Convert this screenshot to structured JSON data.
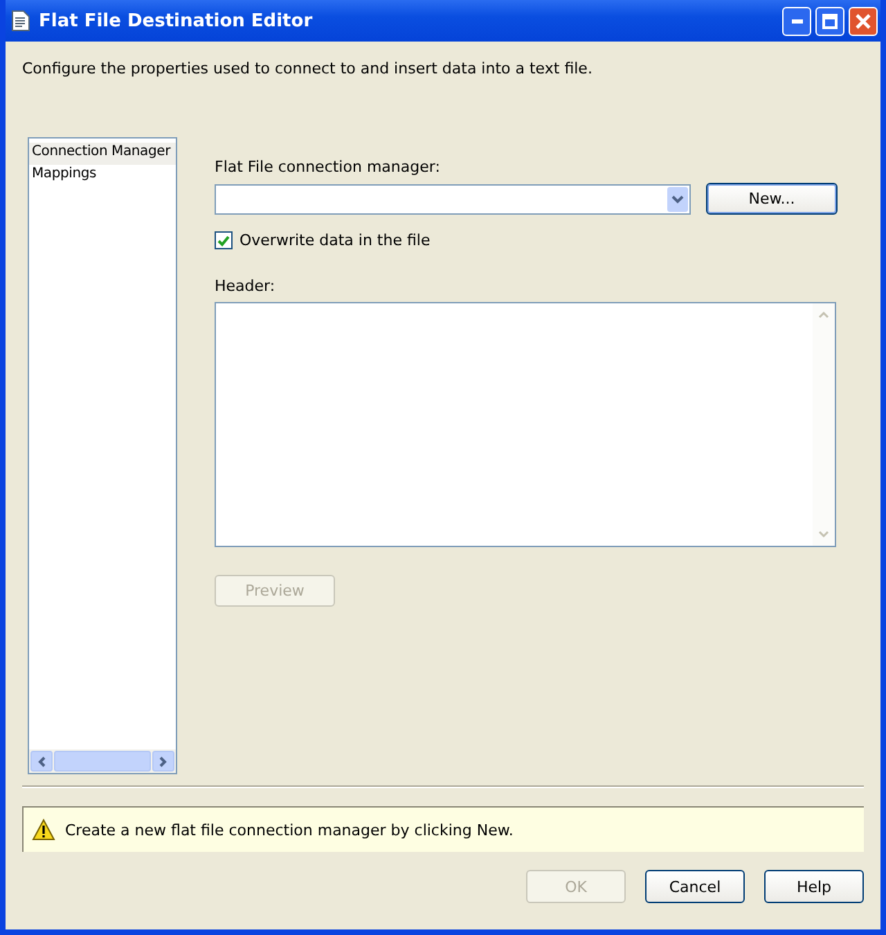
{
  "window": {
    "title": "Flat File Destination Editor"
  },
  "description": "Configure the properties used to connect to and insert data into a text file.",
  "sidebar": {
    "items": [
      {
        "label": "Connection Manager",
        "selected": true
      },
      {
        "label": "Mappings",
        "selected": false
      }
    ]
  },
  "connection": {
    "label": "Flat File connection manager:",
    "new_button": "New..."
  },
  "overwrite": {
    "label": "Overwrite data in the file",
    "checked": true
  },
  "header": {
    "label": "Header:"
  },
  "preview_button": {
    "label": "Preview",
    "disabled": true
  },
  "status": {
    "message": "Create a new flat file connection manager by clicking New."
  },
  "buttons": [
    {
      "label": "OK",
      "disabled": true
    },
    {
      "label": "Cancel",
      "disabled": false
    },
    {
      "label": "Help",
      "disabled": false
    }
  ]
}
